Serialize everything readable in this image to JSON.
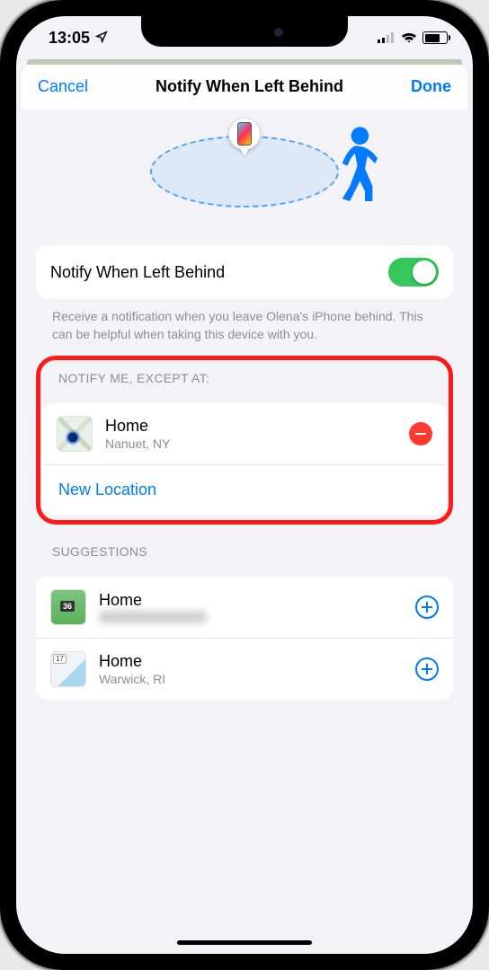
{
  "status": {
    "time": "13:05"
  },
  "nav": {
    "cancel": "Cancel",
    "title": "Notify When Left Behind",
    "done": "Done"
  },
  "toggle": {
    "label": "Notify When Left Behind",
    "description": "Receive a notification when you leave Olena's iPhone behind. This can be helpful when taking this device with you."
  },
  "except": {
    "header": "NOTIFY ME, EXCEPT AT:",
    "items": [
      {
        "name": "Home",
        "sub": "Nanuet, NY"
      }
    ],
    "new_location": "New Location"
  },
  "suggestions": {
    "header": "SUGGESTIONS",
    "items": [
      {
        "name": "Home",
        "sub": ""
      },
      {
        "name": "Home",
        "sub": "Warwick, RI"
      }
    ]
  }
}
